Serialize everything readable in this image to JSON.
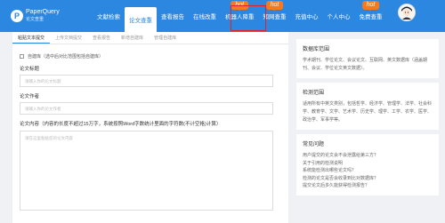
{
  "logo": {
    "mark": "P",
    "name": "PaperQuery",
    "tagline": "论文查重"
  },
  "nav": {
    "items": [
      {
        "label": "文献检索",
        "hot": "",
        "active": false
      },
      {
        "label": "论文查重",
        "hot": "",
        "active": true
      },
      {
        "label": "查看报告",
        "hot": "",
        "active": false
      },
      {
        "label": "在线改重",
        "hot": "",
        "active": false
      },
      {
        "label": "机器人降重",
        "hot": "hot",
        "active": false
      },
      {
        "label": "知网查重",
        "hot": "hot",
        "active": false
      },
      {
        "label": "充值中心",
        "hot": "",
        "active": false
      },
      {
        "label": "个人中心",
        "hot": "",
        "active": false
      },
      {
        "label": "免费查重",
        "hot": "hot",
        "active": false
      }
    ]
  },
  "tabs": [
    "粘贴文本提交",
    "上传文档提交",
    "查看报告",
    "新增自建库",
    "管理自建库"
  ],
  "form": {
    "checkbox_label": "自建库（选中后对比范围包括自建库）",
    "title_label": "论文标题",
    "title_placeholder": "请输入你的论文标题",
    "author_label": "论文作者",
    "author_placeholder": "请输入你的论文作者",
    "content_label": "论文内容（内容的长度不超过15万字，系统按照Word字数统计里面的字符数(不计空格)计算）",
    "content_placeholder": "请在这里粘贴您的论文内容"
  },
  "sidebar": {
    "db_title": "数据库范围",
    "db_text": "学术期刊、学位论文、会议论文、互联网、英文数据库（涵盖期刊、会议、学位论文英文数据）。",
    "scope_title": "检测范围",
    "scope_text": "适用所有中英文类别，包括哲学、经济学、管理学、法学、社会科学、教育学、文学、艺术学、历史学、理学、工学、农学、医学、政治学、军事学等。",
    "faq_title": "常见问题",
    "faq": [
      "用户提交的论文会不会泄露给第三方？",
      "关于引用的检测说明",
      "系统能检测出哪些论文吗？",
      "检测的论文是否会收录到比对数据库？",
      "提交论文后多久能获得检测报告？"
    ]
  }
}
